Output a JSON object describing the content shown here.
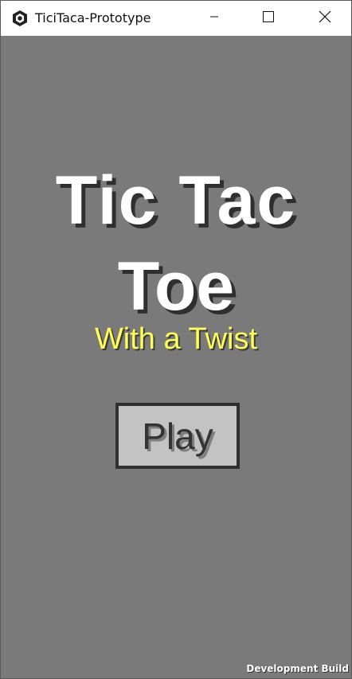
{
  "window": {
    "title": "TiciTaca-Prototype",
    "app_icon": "unity-icon",
    "controls": {
      "minimize_icon": "minimize-icon",
      "maximize_icon": "maximize-icon",
      "close_icon": "close-icon"
    }
  },
  "game": {
    "background_color": "#7a7a7a",
    "title_line1": "Tic Tac",
    "title_line2": "Toe",
    "subtitle": "With a Twist",
    "subtitle_color": "#ffff55",
    "play_label": "Play",
    "dev_build_label": "Development Build"
  }
}
